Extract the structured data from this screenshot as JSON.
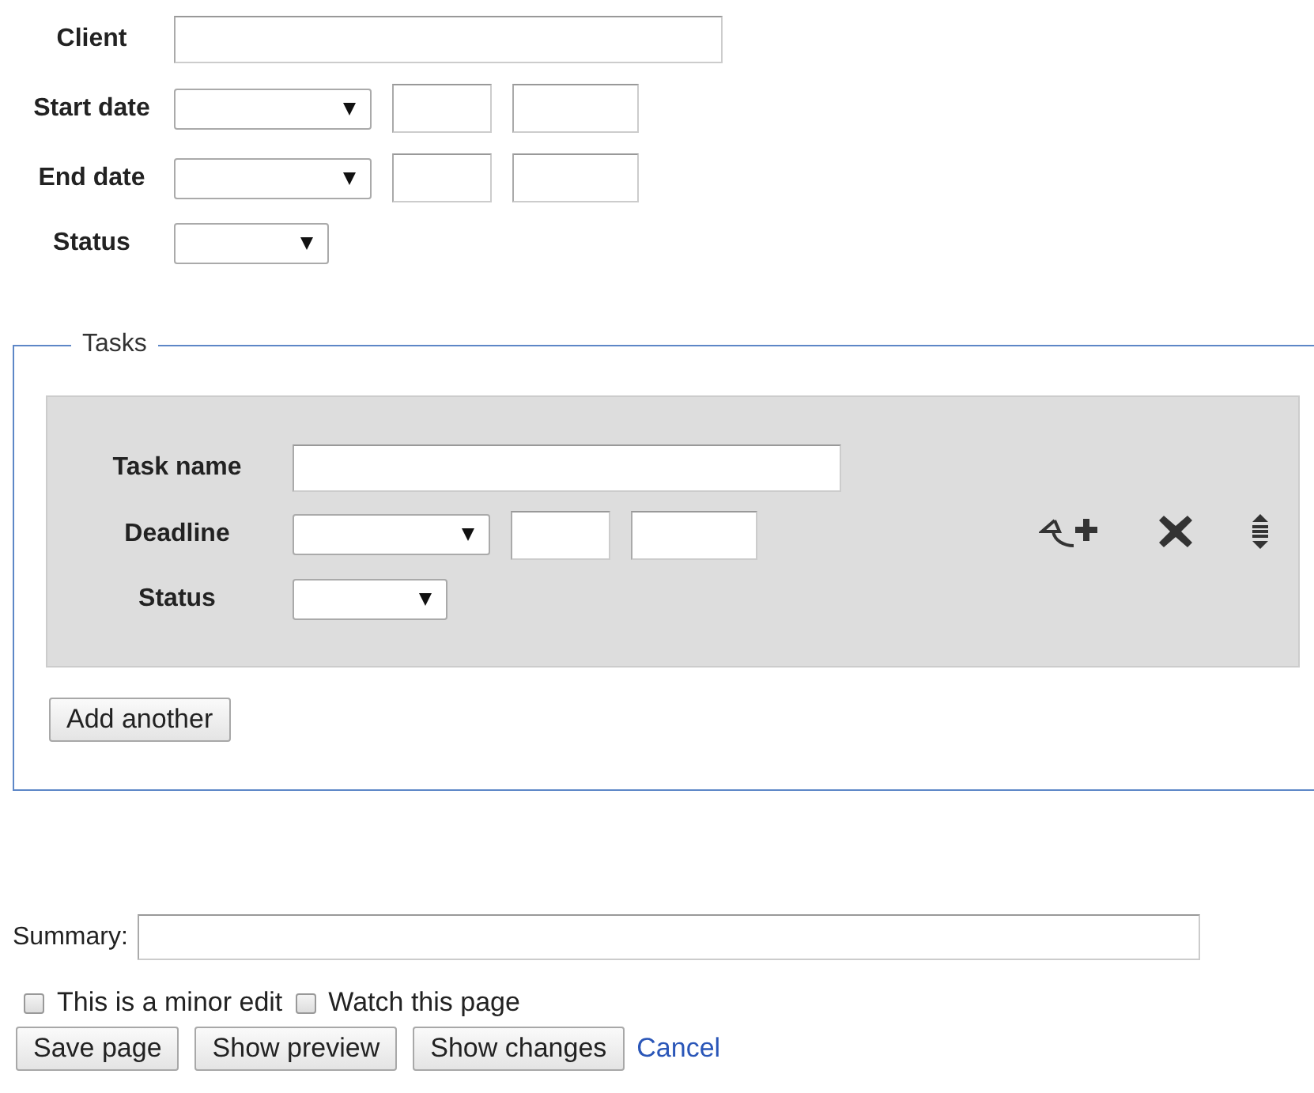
{
  "fields": [
    {
      "kind": "text",
      "label": "Client"
    },
    {
      "kind": "date",
      "label": "Start date"
    },
    {
      "kind": "date",
      "label": "End date"
    },
    {
      "kind": "select",
      "label": "Status"
    }
  ],
  "tasks": {
    "legend": "Tasks",
    "items": [
      {
        "fields": [
          {
            "kind": "text",
            "label": "Task name"
          },
          {
            "kind": "date",
            "label": "Deadline"
          },
          {
            "kind": "select",
            "label": "Status"
          }
        ]
      }
    ],
    "add_button": "Add another"
  },
  "summary": {
    "label": "Summary:"
  },
  "checkboxes": [
    {
      "label": "This is a minor edit",
      "checked": false
    },
    {
      "label": "Watch this page",
      "checked": false
    }
  ],
  "buttons": [
    "Save page",
    "Show preview",
    "Show changes"
  ],
  "cancel_link": "Cancel"
}
